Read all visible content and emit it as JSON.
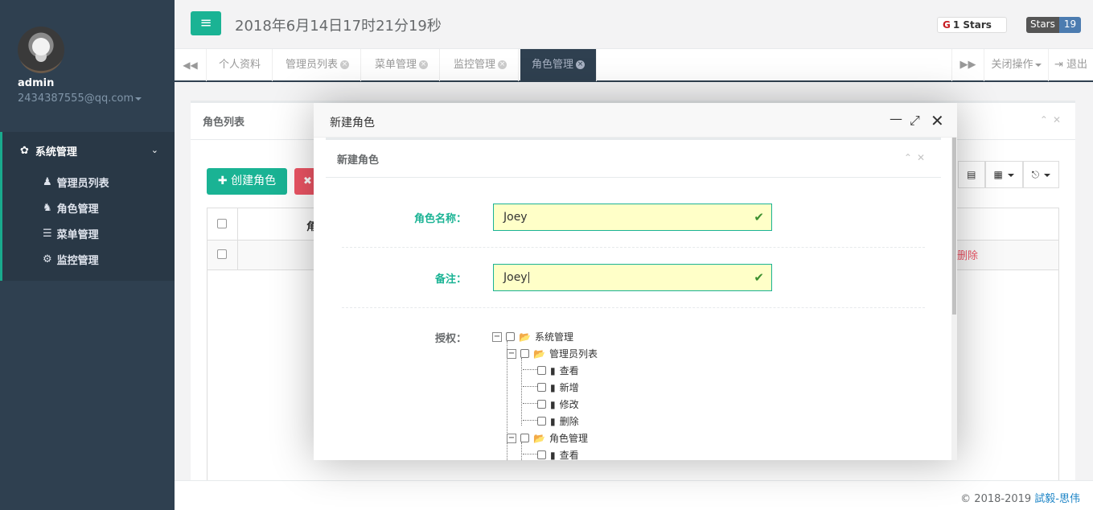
{
  "user": {
    "name": "admin",
    "email": "2434387555@qq.com"
  },
  "sidebar": {
    "group_label": "系统管理",
    "items": [
      {
        "label": "管理员列表",
        "icon": "user-icon"
      },
      {
        "label": "角色管理",
        "icon": "user-secret-icon"
      },
      {
        "label": "菜单管理",
        "icon": "list-icon"
      },
      {
        "label": "监控管理",
        "icon": "cogs-icon"
      }
    ]
  },
  "header": {
    "clock": "2018年6月14日17时21分19秒",
    "gitee_badge": "1 Stars",
    "stars_label": "Stars",
    "stars_count": "19"
  },
  "tabs": [
    {
      "label": "个人资料",
      "closable": false
    },
    {
      "label": "管理员列表",
      "closable": true
    },
    {
      "label": "菜单管理",
      "closable": true
    },
    {
      "label": "监控管理",
      "closable": true
    },
    {
      "label": "角色管理",
      "closable": true,
      "active": true
    }
  ],
  "tabbar": {
    "close_ops": "关闭操作",
    "logout": "退出"
  },
  "page": {
    "panel_title": "角色列表",
    "create_button": "创建角色",
    "table_header_partial": "角",
    "row_delete": "删除"
  },
  "modal": {
    "title": "新建角色",
    "inner_title": "新建角色",
    "fields": {
      "name_label": "角色名称：",
      "name_value": "Joey",
      "remark_label": "备注：",
      "remark_value": "Joey",
      "auth_label": "授权："
    },
    "tree": [
      {
        "label": "系统管理",
        "level": 0,
        "type": "folder",
        "expander": "−"
      },
      {
        "label": "管理员列表",
        "level": 1,
        "type": "folder",
        "expander": "−"
      },
      {
        "label": "查看",
        "level": 2,
        "type": "file"
      },
      {
        "label": "新增",
        "level": 2,
        "type": "file"
      },
      {
        "label": "修改",
        "level": 2,
        "type": "file"
      },
      {
        "label": "删除",
        "level": 2,
        "type": "file"
      },
      {
        "label": "角色管理",
        "level": 1,
        "type": "folder",
        "expander": "−"
      },
      {
        "label": "查看",
        "level": 2,
        "type": "file"
      }
    ]
  },
  "footer": {
    "copyright": "© 2018-2019 ",
    "link": "試毅-思伟"
  },
  "colors": {
    "sidebar": "#2f4050",
    "accent": "#1ab394",
    "danger": "#ed5565",
    "link": "#1c84c6"
  }
}
